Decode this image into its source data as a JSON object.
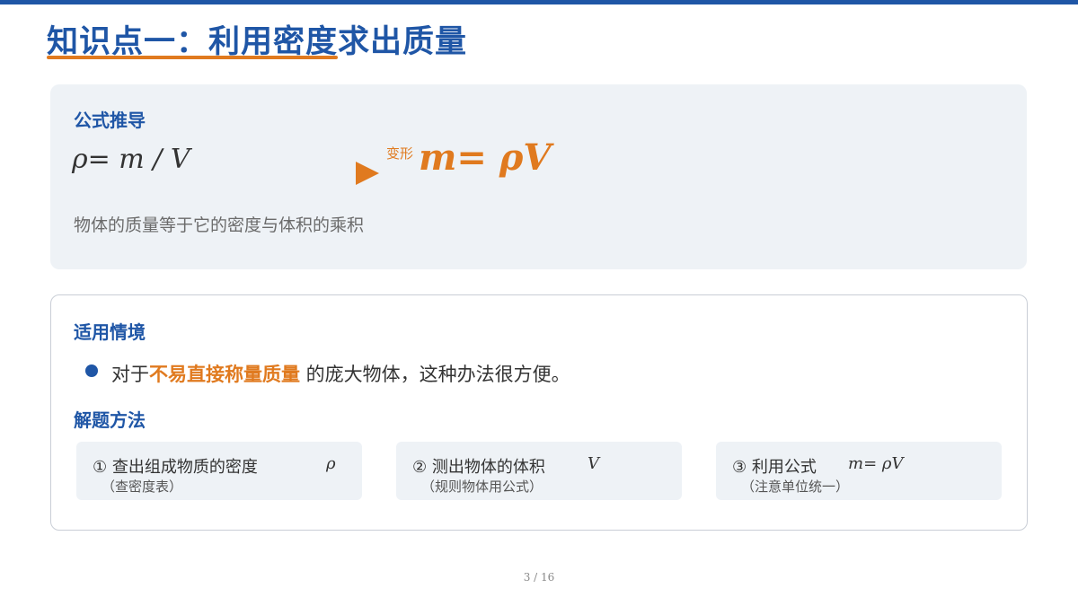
{
  "slide": {
    "title": "知识点一：利用密度求出质量",
    "page_number": "3 / 16"
  },
  "formula_section": {
    "heading": "公式推导",
    "original_formula": "ρ=  m / V",
    "transform_label": "变形",
    "derived_formula": "m= ρV",
    "description": "物体的质量等于它的密度与体积的乘积"
  },
  "application_section": {
    "heading": "适用情境",
    "bullet": {
      "prefix": "对于",
      "highlight": "不易直接称量质量",
      "suffix": " 的庞大物体，这种办法很方便。"
    },
    "method_heading": "解题方法",
    "steps": [
      {
        "title": "① 查出组成物质的密度",
        "symbol": "ρ",
        "note": "（查密度表）"
      },
      {
        "title": "② 测出物体的体积",
        "symbol": "V",
        "note": "（规则物体用公式）"
      },
      {
        "title": "③ 利用公式",
        "symbol": "m=  ρV",
        "note": "（注意单位统一）"
      }
    ]
  },
  "colors": {
    "primary_blue": "#1f56a6",
    "accent_orange": "#e07a1f",
    "panel_gray": "#eef2f6"
  }
}
